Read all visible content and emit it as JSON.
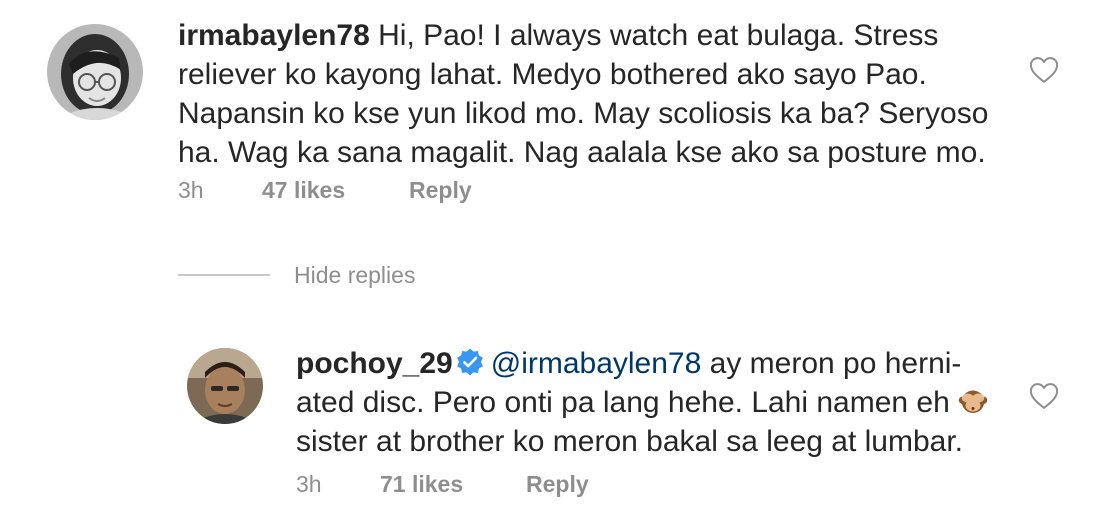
{
  "comments": [
    {
      "username": "irmabaylen78",
      "lines": [
        " Hi, Pao! I always watch eat bulaga. Stress",
        "reliever ko kayong lahat. Medyo bothered ako sayo Pao.",
        "Napansin ko kse yun likod mo. May scoliosis ka ba? Seryoso",
        "ha. Wag ka sana magalit. Nag aalala kse ako sa posture mo."
      ],
      "time": "3h",
      "likes": "47 likes",
      "reply_label": "Reply",
      "avatar_icon": "user-avatar-woman-glasses",
      "like_icon": "heart-outline-icon"
    }
  ],
  "hide_replies_label": "Hide replies",
  "reply": {
    "username": "pochoy_29",
    "verified_icon": "verified-badge-icon",
    "mention": "@irmabaylen78",
    "lines": [
      " ay meron po herni-",
      "ated disc. Pero onti pa lang hehe. Lahi namen eh ",
      "sister at brother ko meron bakal sa leeg at lumbar."
    ],
    "emoji_icon": "see-no-evil-monkey-emoji",
    "time": "3h",
    "likes": "71 likes",
    "reply_label": "Reply",
    "avatar_icon": "user-avatar-man",
    "like_icon": "heart-outline-icon"
  },
  "colors": {
    "text": "#262626",
    "secondary": "#8e8e8e",
    "mention": "#00376b",
    "verified": "#3897f0",
    "divider": "#c7c7c7"
  }
}
